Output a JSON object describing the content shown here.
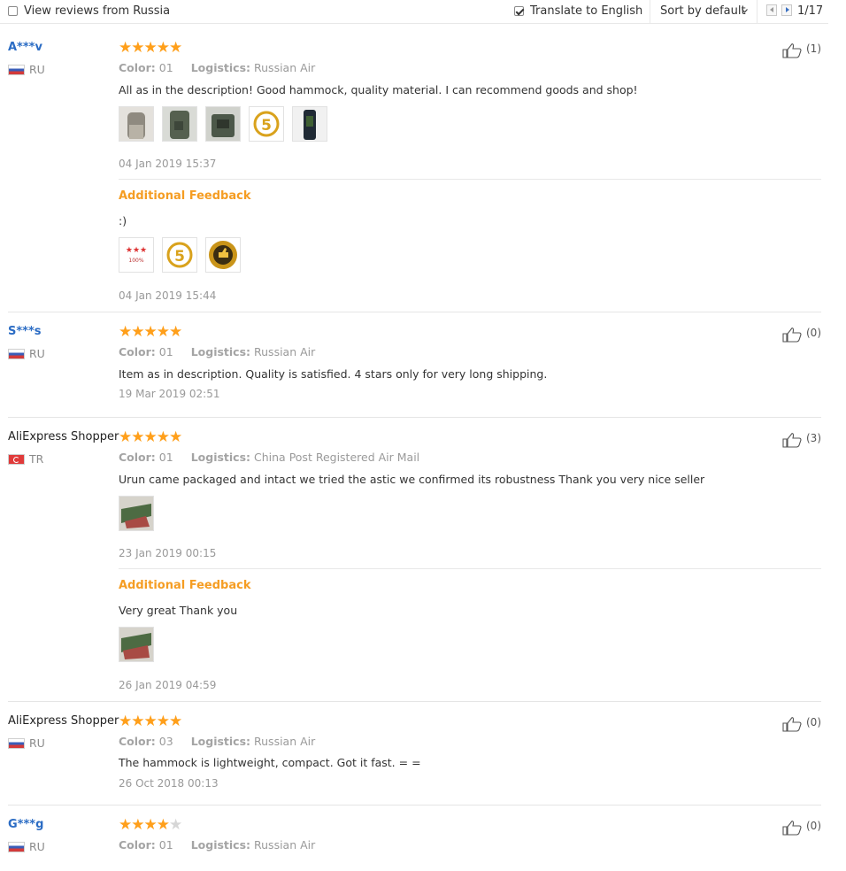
{
  "toolbar": {
    "view_reviews_label": "View reviews from Russia",
    "view_reviews_checked": false,
    "translate_label": "Translate to English",
    "translate_checked": true,
    "sort_label": "Sort by default",
    "page_indicator": "1/17"
  },
  "labels": {
    "color": "Color:",
    "logistics": "Logistics:",
    "additional_feedback": "Additional Feedback"
  },
  "reviews": [
    {
      "user": "A***v",
      "country": "RU",
      "stars": 5,
      "color": "01",
      "logistics": "Russian Air",
      "text": "All as in the description! Good hammock, quality material. I can recommend goods and shop!",
      "date": "04 Jan 2019 15:37",
      "likes": "(1)",
      "additional": {
        "text": ":)",
        "date": "04 Jan 2019 15:44"
      }
    },
    {
      "user": "S***s",
      "country": "RU",
      "stars": 5,
      "color": "01",
      "logistics": "Russian Air",
      "text": "Item as in description. Quality is satisfied. 4 stars only for very long shipping.",
      "date": "19 Mar 2019 02:51",
      "likes": "(0)"
    },
    {
      "user": "AliExpress Shopper",
      "country": "TR",
      "stars": 5,
      "color": "01",
      "logistics": "China Post Registered Air Mail",
      "text": "Urun came packaged and intact we tried the astic we confirmed its robustness Thank you very nice seller",
      "date": "23 Jan 2019 00:15",
      "likes": "(3)",
      "additional": {
        "text": "Very great Thank you",
        "date": "26 Jan 2019 04:59"
      }
    },
    {
      "user": "AliExpress Shopper",
      "country": "RU",
      "stars": 5,
      "color": "03",
      "logistics": "Russian Air",
      "text": "The hammock is lightweight, compact. Got it fast. = =",
      "date": "26 Oct 2018 00:13",
      "likes": "(0)"
    },
    {
      "user": "G***g",
      "country": "RU",
      "stars": 4,
      "color": "01",
      "logistics": "Russian Air",
      "likes": "(0)"
    }
  ],
  "colors": {
    "accent_orange": "#f59d23",
    "star": "#ff9f1a",
    "user_link": "#2b6cc4"
  }
}
